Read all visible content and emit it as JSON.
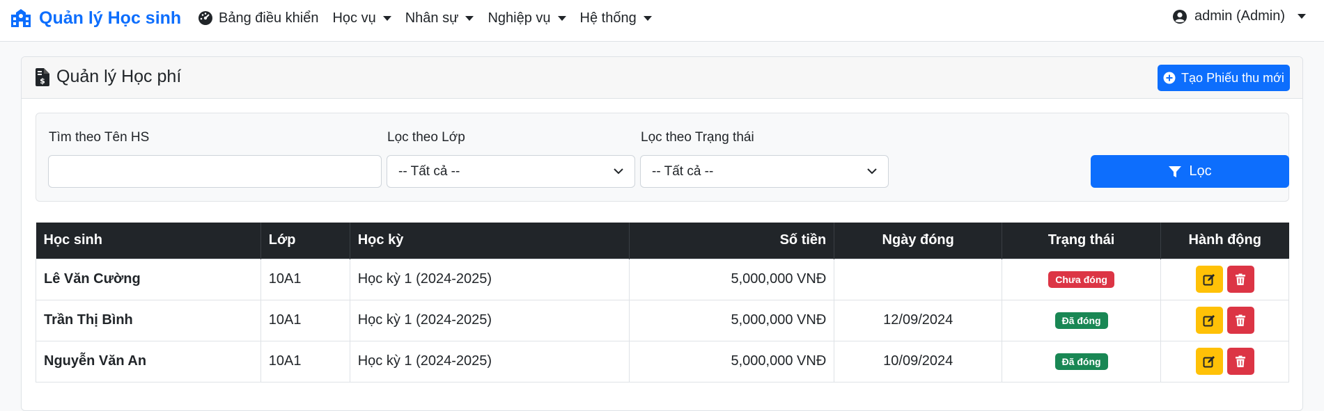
{
  "navbar": {
    "brand": "Quản lý Học sinh",
    "items": [
      {
        "label": "Bảng điều khiển",
        "icon": "dashboard-icon",
        "dropdown": false
      },
      {
        "label": "Học vụ",
        "dropdown": true
      },
      {
        "label": "Nhân sự",
        "dropdown": true
      },
      {
        "label": "Nghiệp vụ",
        "dropdown": true
      },
      {
        "label": "Hệ thống",
        "dropdown": true
      }
    ],
    "user": "admin (Admin)"
  },
  "page": {
    "title": "Quản lý Học phí",
    "new_button": "Tạo Phiếu thu mới"
  },
  "filters": {
    "name_label": "Tìm theo Tên HS",
    "name_value": "",
    "class_label": "Lọc theo Lớp",
    "class_value": "-- Tất cả --",
    "status_label": "Lọc theo Trạng thái",
    "status_value": "-- Tất cả --",
    "filter_button": "Lọc"
  },
  "table": {
    "headers": [
      "Học sinh",
      "Lớp",
      "Học kỳ",
      "Số tiền",
      "Ngày đóng",
      "Trạng thái",
      "Hành động"
    ],
    "rows": [
      {
        "student": "Lê Văn Cường",
        "class": "10A1",
        "term": "Học kỳ 1 (2024-2025)",
        "amount": "5,000,000 VNĐ",
        "date": "",
        "status": "Chưa đóng",
        "status_color": "#dc3545"
      },
      {
        "student": "Trần Thị Bình",
        "class": "10A1",
        "term": "Học kỳ 1 (2024-2025)",
        "amount": "5,000,000 VNĐ",
        "date": "12/09/2024",
        "status": "Đã đóng",
        "status_color": "#198754"
      },
      {
        "student": "Nguyễn Văn An",
        "class": "10A1",
        "term": "Học kỳ 1 (2024-2025)",
        "amount": "5,000,000 VNĐ",
        "date": "10/09/2024",
        "status": "Đã đóng",
        "status_color": "#198754"
      }
    ]
  },
  "colors": {
    "primary": "#0d6efd",
    "warning": "#ffc107",
    "danger": "#dc3545",
    "success": "#198754",
    "dark": "#212529"
  }
}
